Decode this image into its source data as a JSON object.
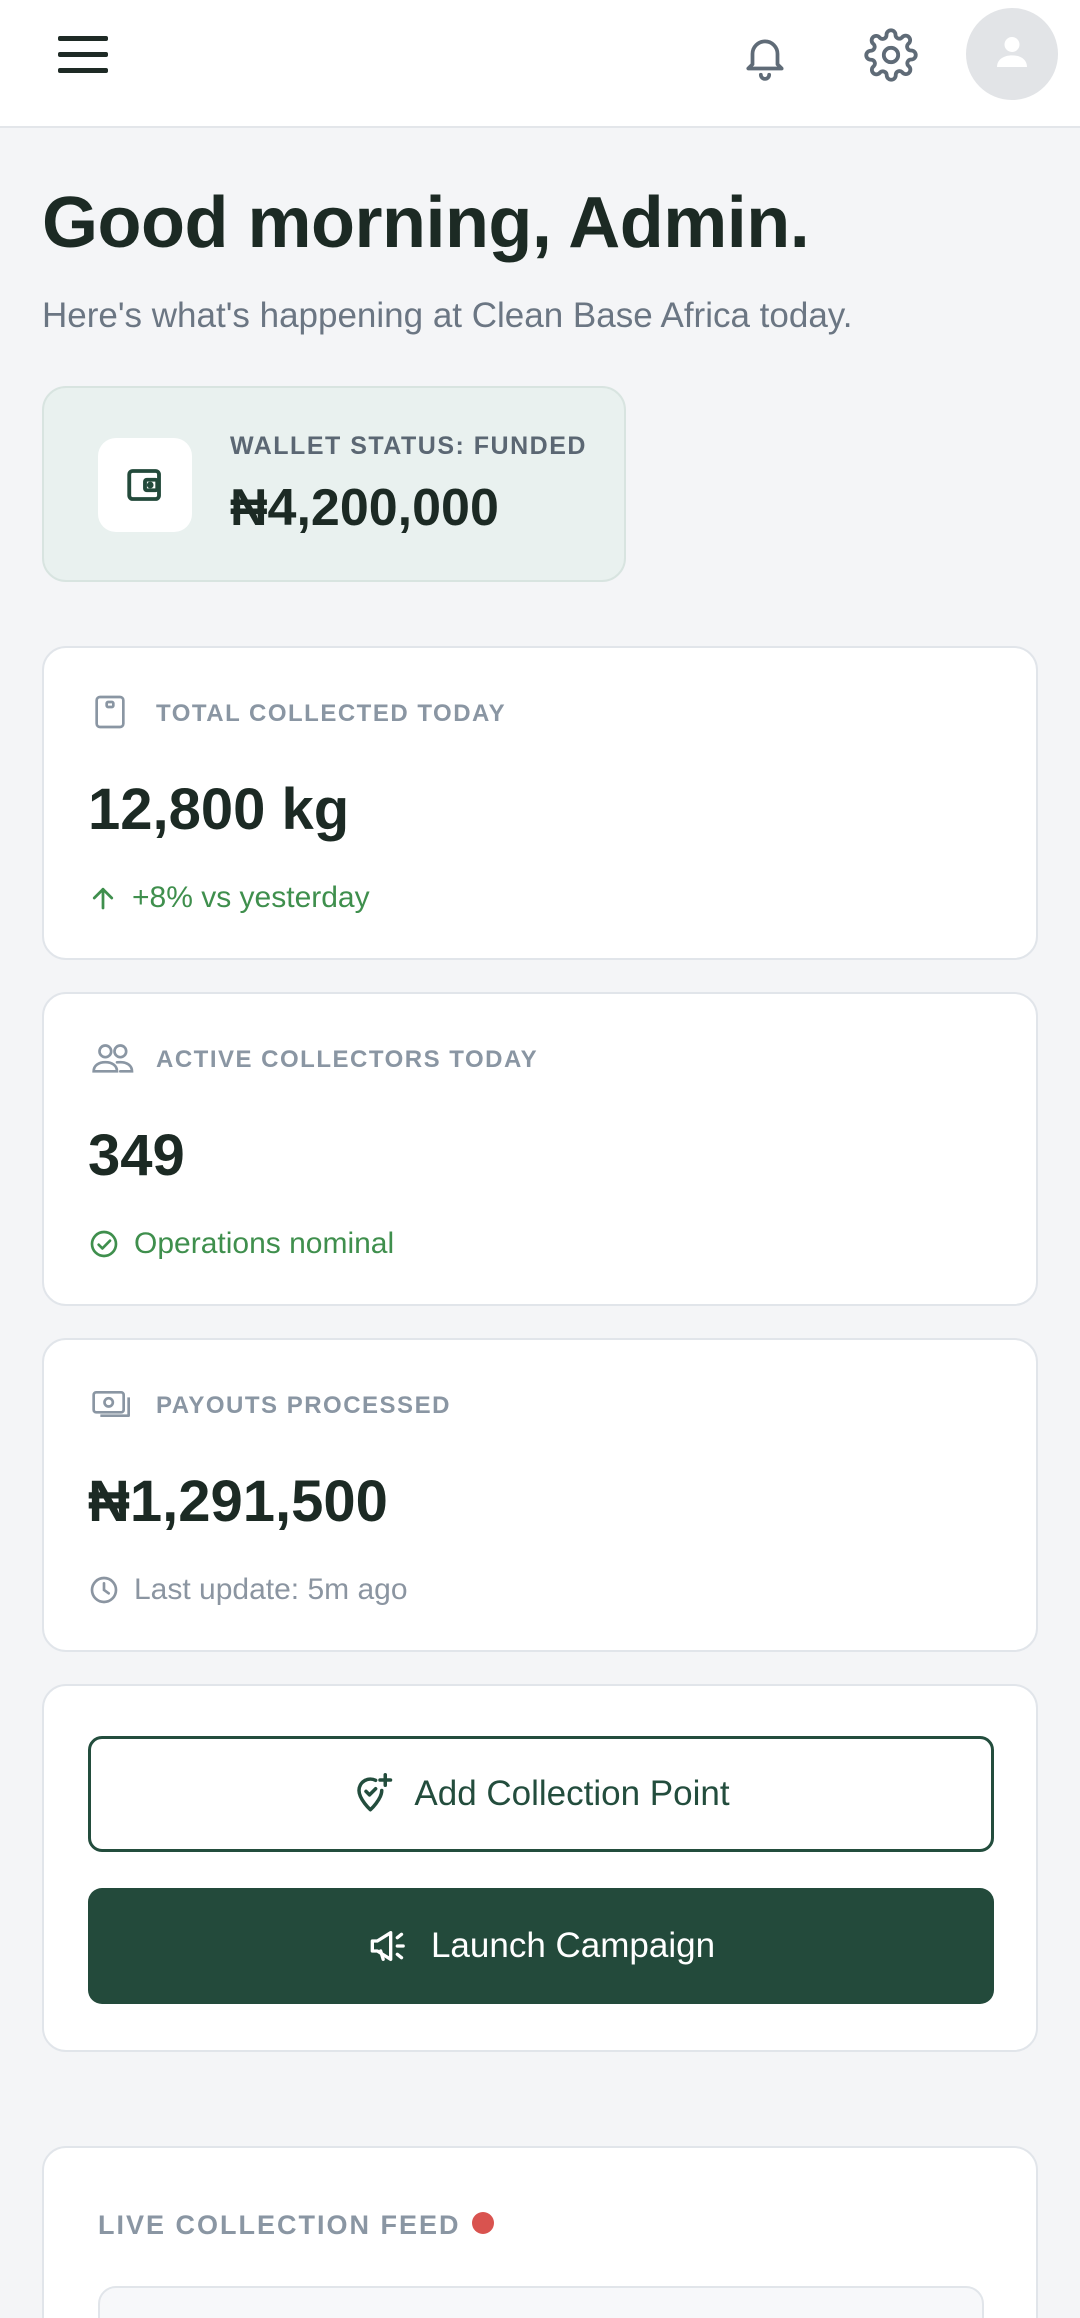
{
  "header": {
    "icons": [
      "menu-icon",
      "bell-icon",
      "gear-icon",
      "user-icon"
    ]
  },
  "greeting": {
    "title": "Good morning, Admin.",
    "subtitle": "Here's what's happening at Clean Base Africa today."
  },
  "wallet": {
    "icon": "wallet-icon",
    "label": "WALLET STATUS: FUNDED",
    "amount": "₦4,200,000"
  },
  "stats": [
    {
      "icon": "clipboard-icon",
      "label": "TOTAL COLLECTED TODAY",
      "value": "12,800 kg",
      "note_icon": "arrow-up-icon",
      "note": "+8% vs yesterday"
    },
    {
      "icon": "users-icon",
      "label": "ACTIVE COLLECTORS TODAY",
      "value": "349",
      "note_icon": "check-circle-icon",
      "note": "Operations nominal"
    },
    {
      "icon": "cash-icon",
      "label": "PAYOUTS PROCESSED",
      "value": "₦1,291,500",
      "note_icon": "clock-icon",
      "note": "Last update: 5m ago"
    }
  ],
  "actions": {
    "add_point_label": "Add Collection Point",
    "add_point_icon": "add-location-icon",
    "campaign_label": "Launch Campaign",
    "campaign_icon": "megaphone-icon"
  },
  "feed": {
    "title": "LIVE COLLECTION FEED"
  },
  "colors": {
    "brand": "#234a3b",
    "positive": "#3f8f4d",
    "live": "#d9534f",
    "wallet_bg": "#e9f1ef"
  }
}
